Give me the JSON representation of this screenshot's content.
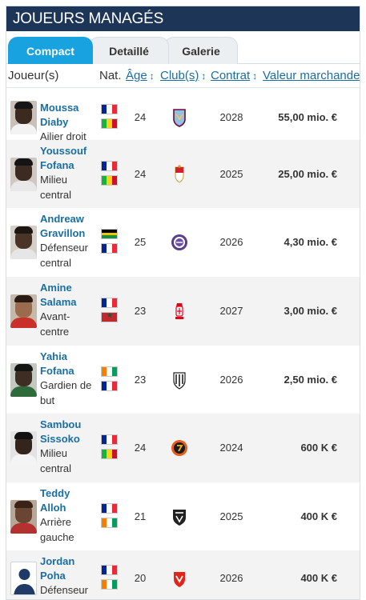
{
  "box": {
    "title": "JOUEURS MANAGÉS"
  },
  "tabs": [
    {
      "label": "Compact",
      "active": true
    },
    {
      "label": "Detaillé",
      "active": false
    },
    {
      "label": "Galerie",
      "active": false
    }
  ],
  "columns": {
    "player": "Joueur(s)",
    "nat": "Nat.",
    "age": "Âge",
    "club": "Club(s)",
    "contract": "Contrat",
    "value": "Valeur marchande",
    "sort_arrow": "↕"
  },
  "players": [
    {
      "name": "Moussa Diaby",
      "position": "Ailier droit",
      "flags": [
        "france",
        "mali"
      ],
      "age": "24",
      "club_icon": "aston-villa-crest",
      "contract": "2028",
      "value": "55,00 mio. €",
      "photo": {
        "skin": "#3a2a20",
        "hair": "#161616",
        "shirt": "#f3f3f3",
        "bg": "#c9c1b8"
      }
    },
    {
      "name": "Youssouf Fofana",
      "position": "Milieu central",
      "flags": [
        "france",
        "mali"
      ],
      "age": "24",
      "club_icon": "as-monaco-crest",
      "contract": "2025",
      "value": "25,00 mio. €",
      "photo": {
        "skin": "#3b2b22",
        "hair": "#141414",
        "shirt": "#e8e8e8",
        "bg": "#cfc8c0"
      }
    },
    {
      "name": "Andreaw Gravillon",
      "position": "Défenseur central",
      "flags": [
        "guadeloupe",
        "france"
      ],
      "age": "25",
      "club_icon": "toulouse-fc-crest",
      "contract": "2026",
      "value": "4,30 mio. €",
      "photo": {
        "skin": "#4a3428",
        "hair": "#1d1612",
        "shirt": "#e6e6e6",
        "bg": "#d6cfc7"
      }
    },
    {
      "name": "Amine Salama",
      "position": "Avant-centre",
      "flags": [
        "france",
        "morocco"
      ],
      "age": "23",
      "club_icon": "stade-de-reims-crest",
      "contract": "2027",
      "value": "3,00 mio. €",
      "photo": {
        "skin": "#9a6b4d",
        "hair": "#2a1c14",
        "shirt": "#c9302c",
        "bg": "#c7b9aa"
      }
    },
    {
      "name": "Yahia Fofana",
      "position": "Gardien de but",
      "flags": [
        "ivory-coast",
        "france"
      ],
      "age": "23",
      "club_icon": "angers-sco-crest",
      "contract": "2026",
      "value": "2,50 mio. €",
      "photo": {
        "skin": "#3e2d23",
        "hair": "#151515",
        "shirt": "#2f6b3a",
        "bg": "#c4c9bf"
      }
    },
    {
      "name": "Sambou Sissoko",
      "position": "Milieu central",
      "flags": [
        "france",
        "mali"
      ],
      "age": "24",
      "club_icon": "club-crest-orange",
      "contract": "2024",
      "value": "600 K €",
      "photo": {
        "skin": "#33241c",
        "hair": "#111111",
        "shirt": "#f4f4f4",
        "bg": "#e3e3e3"
      }
    },
    {
      "name": "Teddy Alloh",
      "position": "Arrière gauche",
      "flags": [
        "france",
        "ivory-coast"
      ],
      "age": "21",
      "club_icon": "kas-eupen-crest",
      "contract": "2025",
      "value": "400 K €",
      "photo": {
        "skin": "#6a4533",
        "hair": "#3a2217",
        "shirt": "#b3312f",
        "bg": "#b8a697"
      }
    },
    {
      "name": "Jordan Poha",
      "position": "Défenseur central",
      "flags": [
        "france",
        "ivory-coast"
      ],
      "age": "20",
      "club_icon": "valenciennes-fc-crest",
      "contract": "2026",
      "value": "400 K €",
      "photo": {
        "placeholder": true
      }
    }
  ],
  "flag_colors": {
    "france": [
      "#002395",
      "#ffffff",
      "#ed2939"
    ],
    "mali": [
      "#14b53a",
      "#fcd116",
      "#ce1126"
    ],
    "ivory-coast": [
      "#f77f00",
      "#ffffff",
      "#009e60"
    ],
    "morocco": [
      "#c1272d"
    ],
    "guadeloupe": [
      "#000000",
      "#f2c500",
      "#000000"
    ]
  },
  "colors": {
    "header_bg": "#1d3557",
    "active_tab": "#18a2e0",
    "link": "#1a6ea1",
    "row_alt": "#f3f3f3"
  }
}
